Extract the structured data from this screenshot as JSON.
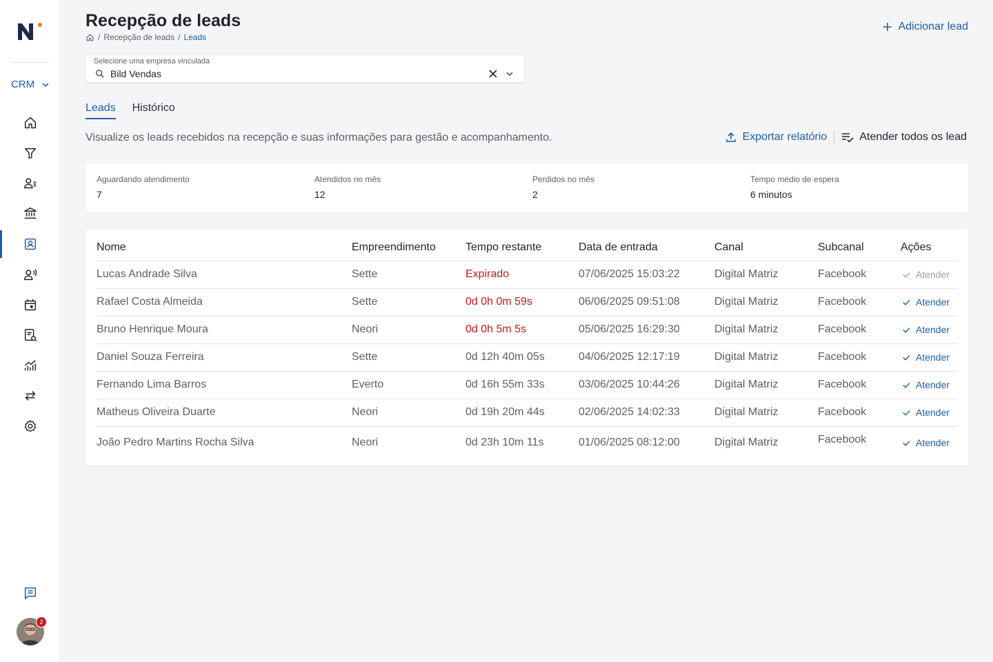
{
  "app": {
    "brand_letter": "N",
    "module": "CRM",
    "notification_count": "2",
    "accent_color": "#1c5fa8",
    "alert_color": "#c41a1a"
  },
  "sidebar": {
    "items": [
      {
        "icon": "home-icon"
      },
      {
        "icon": "funnel-icon"
      },
      {
        "icon": "contacts-icon"
      },
      {
        "icon": "bank-icon"
      },
      {
        "icon": "lead-reception-icon",
        "active": true
      },
      {
        "icon": "voice-contact-icon"
      },
      {
        "icon": "calendar-icon"
      },
      {
        "icon": "reports-icon"
      },
      {
        "icon": "analytics-icon"
      },
      {
        "icon": "transfer-icon"
      },
      {
        "icon": "settings-icon"
      }
    ],
    "bottom": {
      "icon": "chat-icon"
    }
  },
  "header": {
    "title": "Recepção de leads",
    "breadcrumb": [
      "Recepção de leads",
      "Leads"
    ],
    "add_label": "Adicionar lead"
  },
  "company_select": {
    "label": "Selecione uma empresa vinculada",
    "value": "Bild Vendas"
  },
  "tabs": [
    {
      "label": "Leads",
      "active": true
    },
    {
      "label": "Histórico",
      "active": false
    }
  ],
  "description": "Visualize os leads recebidos na recepção e suas informações para gestão e acompanhamento.",
  "actions": {
    "export_label": "Exportar relatório",
    "attend_all_label": "Atender todos os lead"
  },
  "stats": [
    {
      "label": "Aguardando atendimento",
      "value": "7"
    },
    {
      "label": "Atendidos no mês",
      "value": "12"
    },
    {
      "label": "Perdidos no mês",
      "value": "2"
    },
    {
      "label": "Tempo médio de espera",
      "value": "6 minutos"
    }
  ],
  "table": {
    "headers": [
      "Nome",
      "Empreendimento",
      "Tempo restante",
      "Data de entrada",
      "Canal",
      "Subcanal",
      "Ações"
    ],
    "rows": [
      {
        "nome": "Lucas Andrade Silva",
        "empreendimento": "Sette",
        "tempo": "Expirado",
        "urgent": true,
        "data": "07/06/2025 15:03:22",
        "canal": "Digital Matriz",
        "subcanal": "Facebook",
        "acao": "Atender",
        "enabled": false
      },
      {
        "nome": "Rafael Costa Almeida",
        "empreendimento": "Sette",
        "tempo": "0d 0h 0m 59s",
        "urgent": true,
        "data": "06/06/2025 09:51:08",
        "canal": "Digital Matriz",
        "subcanal": "Facebook",
        "acao": "Atender",
        "enabled": true
      },
      {
        "nome": "Bruno Henrique Moura",
        "empreendimento": "Neori",
        "tempo": "0d 0h 5m 5s",
        "urgent": true,
        "data": "05/06/2025 16:29:30",
        "canal": "Digital Matriz",
        "subcanal": "Facebook",
        "acao": "Atender",
        "enabled": true
      },
      {
        "nome": "Daniel Souza Ferreira",
        "empreendimento": "Sette",
        "tempo": "0d 12h 40m 05s",
        "urgent": false,
        "data": "04/06/2025 12:17:19",
        "canal": "Digital Matriz",
        "subcanal": "Facebook",
        "acao": "Atender",
        "enabled": true
      },
      {
        "nome": "Fernando Lima Barros",
        "empreendimento": "Everto",
        "tempo": "0d 16h 55m 33s",
        "urgent": false,
        "data": "03/06/2025 10:44:26",
        "canal": "Digital Matriz",
        "subcanal": "Facebook",
        "acao": "Atender",
        "enabled": true
      },
      {
        "nome": "Matheus Oliveira Duarte",
        "empreendimento": "Neori",
        "tempo": "0d 19h 20m 44s",
        "urgent": false,
        "data": "02/06/2025 14:02:33",
        "canal": "Digital Matriz",
        "subcanal": "Facebook",
        "acao": "Atender",
        "enabled": true
      },
      {
        "nome": "João Pedro Martins Rocha Silva",
        "empreendimento": "Neori",
        "tempo": "0d 23h 10m 11s",
        "urgent": false,
        "data": "01/06/2025 08:12:00",
        "canal": "Digital Matriz",
        "subcanal": "Facebook",
        "acao": "Atender",
        "enabled": true
      }
    ]
  }
}
